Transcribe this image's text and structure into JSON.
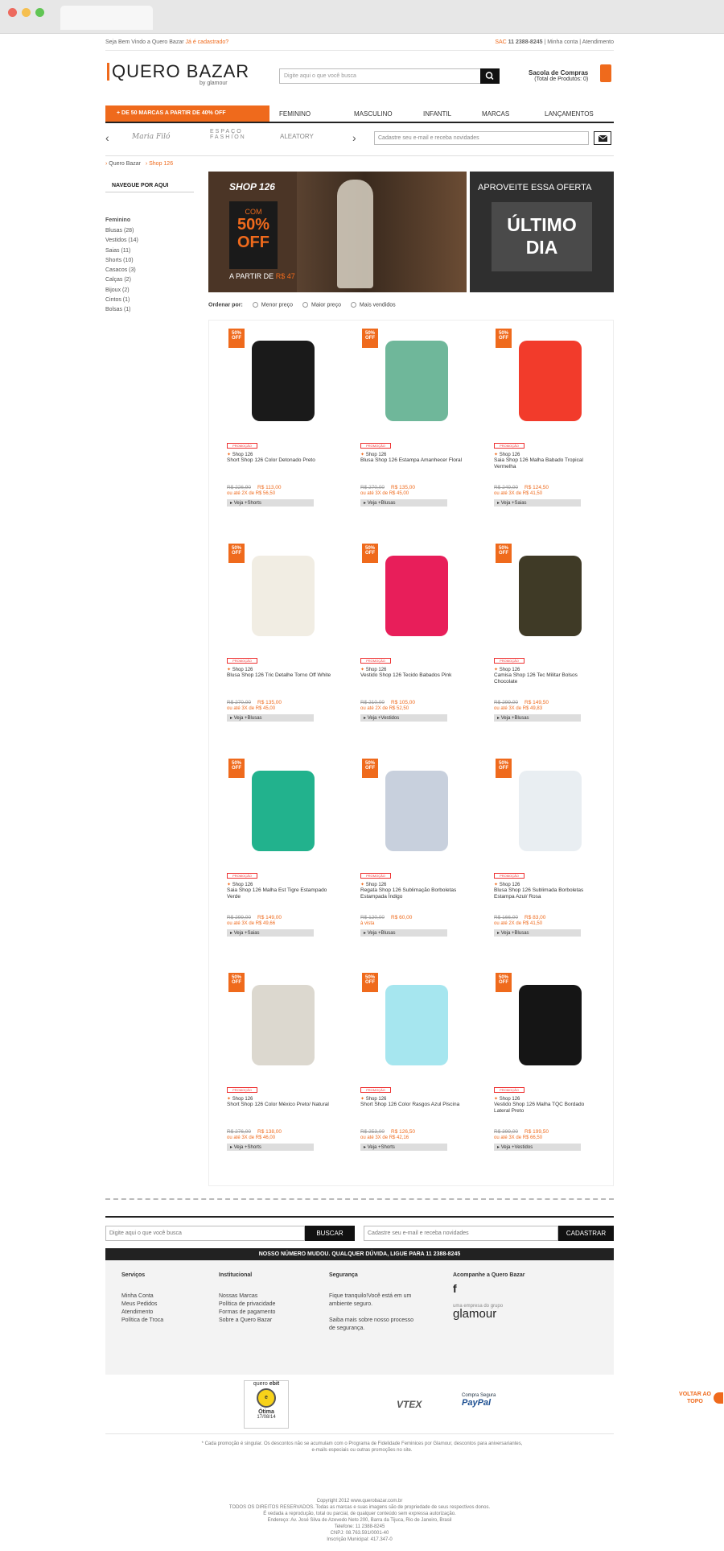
{
  "top": {
    "welcome": "Seja Bem Vindo a Quero Bazar",
    "register": "Já é cadastrado?",
    "sac_label": "SAC",
    "phone": "11 2388-8245",
    "account": "Minha conta",
    "help": "Atendimento"
  },
  "logo": {
    "main": "QUERO BAZAR",
    "by": "by glamour"
  },
  "search": {
    "placeholder": "Digite aqui o que você busca"
  },
  "cart": {
    "title": "Sacola de Compras",
    "subtitle": "(Total de Produtos:",
    "count": "0"
  },
  "nav": {
    "promo": "+ DE 50 MARCAS A PARTIR DE 40% OFF",
    "items": [
      "FEMININO",
      "MASCULINO",
      "INFANTIL",
      "MARCAS",
      "LANÇAMENTOS"
    ]
  },
  "brands": [
    "Maria Filó",
    "ESPAÇO FASHION",
    "ALEATORY"
  ],
  "newsletter": {
    "placeholder": "Cadastre seu e-mail e receba novidades"
  },
  "breadcrumb": [
    "Quero Bazar",
    "Shop 126"
  ],
  "sidebar": {
    "title": "NAVEGUE POR AQUI",
    "section": "Feminino",
    "items": [
      "Blusas (28)",
      "Vestidos (14)",
      "Saias (11)",
      "Shorts (10)",
      "Casacos (3)",
      "Calças (2)",
      "Bijoux (2)",
      "Cintos (1)",
      "Bolsas (1)"
    ]
  },
  "banner": {
    "brand": "SHOP 126",
    "com": "COM",
    "off1": "50%",
    "off2": "OFF",
    "from": "A PARTIR DE",
    "price": "R$ 47",
    "right_title": "APROVEITE ESSA OFERTA",
    "last1": "ÚLTIMO",
    "last2": "DIA"
  },
  "sort": {
    "label": "Ordenar por:",
    "options": [
      "Menor preço",
      "Maior preço",
      "Mais vendidos"
    ]
  },
  "products": [
    {
      "name": "Short Shop 126 Color Detonado Preto",
      "brand": "Shop 126",
      "old": "R$ 226,90",
      "new": "R$ 113,00",
      "inst": "ou até 2X de R$ 56,50",
      "cat": "Veja +Shorts",
      "color": "#1a1a1a",
      "badge": "50% OFF"
    },
    {
      "name": "Blusa Shop 126 Estampa Amanhecer Floral",
      "brand": "Shop 126",
      "old": "R$ 270,00",
      "new": "R$ 135,00",
      "inst": "ou até 3X de R$ 45,00",
      "cat": "Veja +Blusas",
      "color": "#6fb79a",
      "badge": "50% OFF"
    },
    {
      "name": "Saia Shop 126 Malha Babado Tropical Vermelha",
      "brand": "Shop 126",
      "old": "R$ 249,00",
      "new": "R$ 124,50",
      "inst": "ou até 3X de R$ 41,50",
      "cat": "Veja +Saias",
      "color": "#f23b2b",
      "badge": "50% OFF"
    },
    {
      "name": "Blusa Shop 126 Tric Detalhe Torno Off White",
      "brand": "Shop 126",
      "old": "R$ 270,00",
      "new": "R$ 135,00",
      "inst": "ou até 3X de R$ 45,00",
      "cat": "Veja +Blusas",
      "color": "#f1ede3",
      "badge": "50% OFF"
    },
    {
      "name": "Vestido Shop 126 Tecido Babados Pink",
      "brand": "Shop 126",
      "old": "R$ 210,00",
      "new": "R$ 105,00",
      "inst": "ou até 2X de R$ 52,50",
      "cat": "Veja +Vestidos",
      "color": "#e81e5a",
      "badge": "50% OFF"
    },
    {
      "name": "Camisa Shop 126 Tec Militar Bolsos Chocolate",
      "brand": "Shop 126",
      "old": "R$ 299,00",
      "new": "R$ 149,50",
      "inst": "ou até 3X de R$ 49,83",
      "cat": "Veja +Blusas",
      "color": "#3f3a26",
      "badge": "50% OFF"
    },
    {
      "name": "Saia Shop 126 Malha Est Tigre Estampado Verde",
      "brand": "Shop 126",
      "old": "R$ 299,00",
      "new": "R$ 149,00",
      "inst": "ou até 3X de R$ 49,66",
      "cat": "Veja +Saias",
      "color": "#22b28d",
      "badge": "50% OFF"
    },
    {
      "name": "Regata Shop 126 Sublimação Borboletas Estampada Índigo",
      "brand": "Shop 126",
      "old": "R$ 120,00",
      "new": "R$ 60,00",
      "inst": "à vista",
      "cat": "Veja +Blusas",
      "color": "#c8d0dd",
      "badge": "50% OFF"
    },
    {
      "name": "Blusa Shop 126 Sublimada Borboletas Estampa Azul/ Rosa",
      "brand": "Shop 126",
      "old": "R$ 166,00",
      "new": "R$ 83,00",
      "inst": "ou até 2X de R$ 41,50",
      "cat": "Veja +Blusas",
      "color": "#e9eef2",
      "badge": "50% OFF"
    },
    {
      "name": "Short Shop 126 Color México Preto/ Natural",
      "brand": "Shop 126",
      "old": "R$ 276,00",
      "new": "R$ 138,00",
      "inst": "ou até 3X de R$ 46,00",
      "cat": "Veja +Shorts",
      "color": "#dcd8cf",
      "badge": "50% OFF"
    },
    {
      "name": "Short Shop 126 Color Rasgos Azul Piscina",
      "brand": "Shop 126",
      "old": "R$ 253,00",
      "new": "R$ 126,50",
      "inst": "ou até 3X de R$ 42,16",
      "cat": "Veja +Shorts",
      "color": "#a6e6ef",
      "badge": "50% OFF"
    },
    {
      "name": "Vestido Shop 126 Malha TQC Bordado Lateral Preto",
      "brand": "Shop 126",
      "old": "R$ 399,00",
      "new": "R$ 199,50",
      "inst": "ou até 3X de R$ 66,50",
      "cat": "Veja +Vestidos",
      "color": "#151515",
      "badge": "50% OFF"
    }
  ],
  "stamp": "PROMOÇÃO",
  "footer": {
    "search_placeholder": "Digite aqui o que você busca",
    "search_btn": "BUSCAR",
    "news_placeholder": "Cadastre seu e-mail e receba novidades",
    "news_btn": "CADASTRAR",
    "strip": "NOSSO NÚMERO MUDOU. QUALQUER DÚVIDA, LIGUE PARA 11 2388-8245",
    "cols": [
      {
        "title": "Serviços",
        "items": [
          "Minha Conta",
          "Meus Pedidos",
          "Atendimento",
          "Política de Troca"
        ]
      },
      {
        "title": "Institucional",
        "items": [
          "Nossas Marcas",
          "Política de privacidade",
          "Formas de pagamento",
          "Sobre a Quero Bazar"
        ]
      },
      {
        "title": "Segurança",
        "items": [
          "Fique tranquilo!Você está em um ambiente seguro.",
          "Saiba mais sobre nosso processo de segurança."
        ]
      },
      {
        "title": "Acompanhe a Quero Bazar",
        "items": [
          "uma empresa do grupo",
          "glamour"
        ]
      }
    ],
    "ebit": [
      "quero",
      "ebit",
      "Ótima",
      "17/08/14"
    ],
    "vtex": "VTEX",
    "paypal": "PayPal",
    "paypal_top": "Compra Segura",
    "back_top": "VOLTAR AO TOPO",
    "disclaimer": "* Cada promoção é singular. Os descontos não se acumulam com o Programa de Fidelidade Feminices por Glamour, descontos para aniversariantes, e-mails especiais ou outras promoções no site.",
    "copyright": [
      "Copyright 2012 www.querobazar.com.br",
      "TODOS OS DIREITOS RESERVADOS. Todas as marcas e suas imagens são de propriedade de seus respectivos donos.",
      "É vedada a reprodução, total ou parcial, de qualquer conteúdo sem expressa autorização.",
      "Endereço: Av. José Silva de Azevedo Neto 200, Barra da Tijuca, Rio de Janeiro, Brasil",
      "Telefone: 11 2388-8245",
      "CNPJ: 08.763.591/0001-40",
      "Inscrição Municipal: 417.347-0"
    ]
  }
}
